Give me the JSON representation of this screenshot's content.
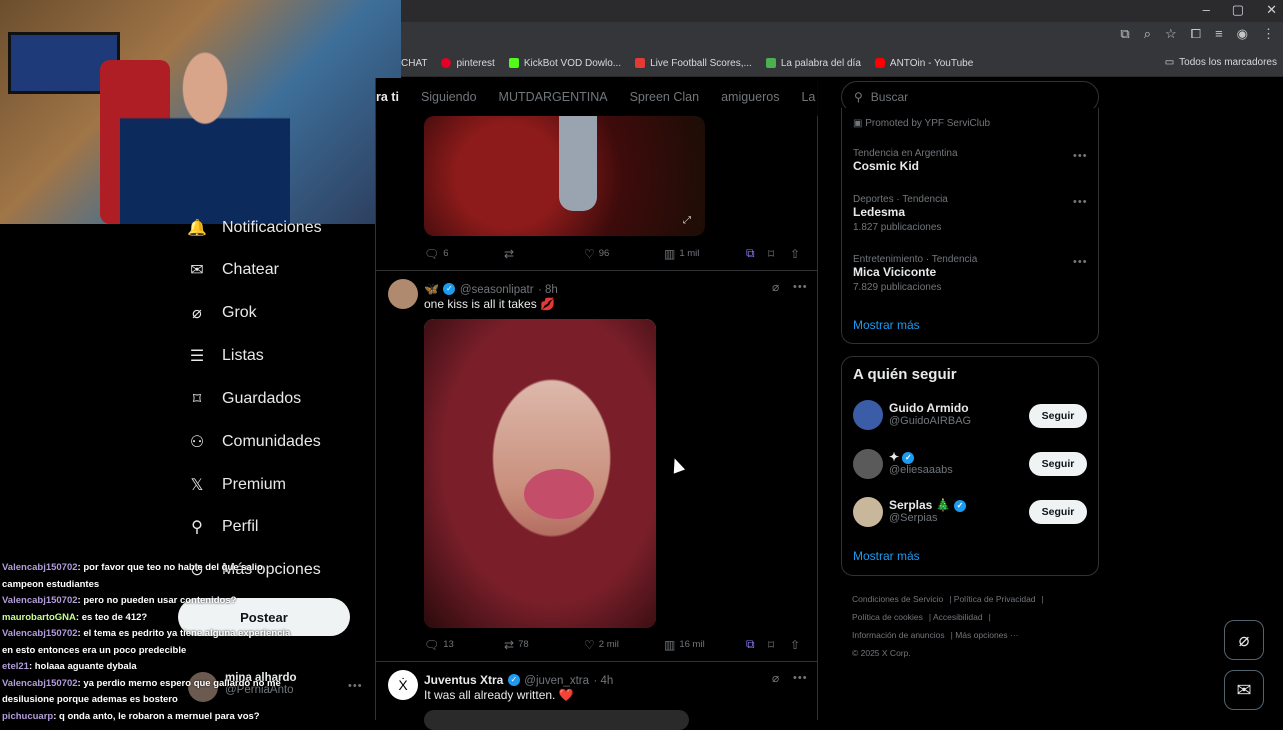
{
  "browser": {
    "window_controls": [
      "–",
      "▢",
      "✕"
    ],
    "bookmarks": [
      {
        "label": "CHAT",
        "icon": "none"
      },
      {
        "label": "pinterest",
        "icon": "pinterest-icon",
        "color": "#e60023"
      },
      {
        "label": "KickBot VOD Dowlo...",
        "icon": "kick-icon",
        "color": "#53fc18"
      },
      {
        "label": "Live Football Scores,...",
        "icon": "football-icon",
        "color": "#e53935"
      },
      {
        "label": "La palabra del día",
        "icon": "p-icon",
        "color": "#4caf50"
      },
      {
        "label": "ANTOin - YouTube",
        "icon": "youtube-icon",
        "color": "#ff0000"
      }
    ],
    "all_bookmarks": "Todos los marcadores"
  },
  "nav": {
    "items": [
      {
        "label": "Notificaciones",
        "icon": "bell-icon"
      },
      {
        "label": "Chatear",
        "icon": "mail-icon"
      },
      {
        "label": "Grok",
        "icon": "grok-icon"
      },
      {
        "label": "Listas",
        "icon": "list-icon"
      },
      {
        "label": "Guardados",
        "icon": "bookmark-icon"
      },
      {
        "label": "Comunidades",
        "icon": "communities-icon"
      },
      {
        "label": "Premium",
        "icon": "x-icon"
      },
      {
        "label": "Perfil",
        "icon": "person-icon"
      },
      {
        "label": "Más opciones",
        "icon": "more-circle-icon"
      }
    ],
    "post_button": "Postear",
    "account": {
      "name": "mina alhardo",
      "handle": "@PerniaAnto"
    }
  },
  "chat": [
    {
      "user": "Valencabj150702",
      "msg": ": por favor que teo no hable del que salio campeon estudiantes"
    },
    {
      "user": "Valencabj150702",
      "msg": ": pero no pueden usar contenidos?"
    },
    {
      "user": "maurobartoGNA",
      "msg": ": es teo de 412?"
    },
    {
      "user": "Valencabj150702",
      "msg": ": el tema es pedrito ya tiene alguna experiencia en esto entonces era un poco predecible"
    },
    {
      "user": "etel21",
      "msg": ": holaaa aguante dybala"
    },
    {
      "user": "Valencabj150702",
      "msg": ": ya perdio merno espero que gallardo no me desilusione porque ademas es bostero"
    },
    {
      "user": "pichucuarp",
      "msg": ": q onda anto, le robaron a mernuel para vos?"
    }
  ],
  "timeline": {
    "tabs": [
      "ra ti",
      "Siguiendo",
      "MUTDARGENTINA",
      "Spreen Clan",
      "amigueros",
      "La"
    ],
    "tweet1_actions": {
      "replies": "6",
      "reposts": "",
      "likes": "96",
      "views": "1 mil"
    },
    "tweet2": {
      "name": "🦋",
      "handle": "@seasonlipatr",
      "time": "· 8h",
      "text": "one kiss is all it takes 💋",
      "actions": {
        "replies": "13",
        "reposts": "78",
        "likes": "2 mil",
        "views": "16 mil"
      }
    },
    "tweet3": {
      "name": "Juventus Xtra",
      "handle": "@juven_xtra",
      "time": "· 4h",
      "text": "It was all already written. ❤️"
    }
  },
  "sidebar": {
    "search_placeholder": "Buscar",
    "promoted": "Promoted by YPF ServiClub",
    "trends": [
      {
        "meta": "Tendencia en Argentina",
        "name": "Cosmic Kid",
        "count": ""
      },
      {
        "meta": "Deportes · Tendencia",
        "name": "Ledesma",
        "count": "1.827 publicaciones"
      },
      {
        "meta": "Entretenimiento · Tendencia",
        "name": "Mica Viciconte",
        "count": "7.829 publicaciones"
      }
    ],
    "show_more": "Mostrar más",
    "who_to_follow": {
      "title": "A quién seguir",
      "accounts": [
        {
          "name": "Guido Armido",
          "handle": "@GuidoAIRBAG",
          "button": "Seguir"
        },
        {
          "name": "✦",
          "handle": "@eliesaaabs",
          "button": "Seguir"
        },
        {
          "name": "Serplas 🎄",
          "handle": "@Serpias",
          "button": "Seguir"
        }
      ],
      "show_more": "Mostrar más"
    },
    "footer": {
      "links": [
        "Condiciones de Servicio",
        "Política de Privacidad",
        "Política de cookies",
        "Accesibilidad",
        "Información de anuncios",
        "Más opciones ···"
      ],
      "copyright": "© 2025 X Corp."
    }
  }
}
